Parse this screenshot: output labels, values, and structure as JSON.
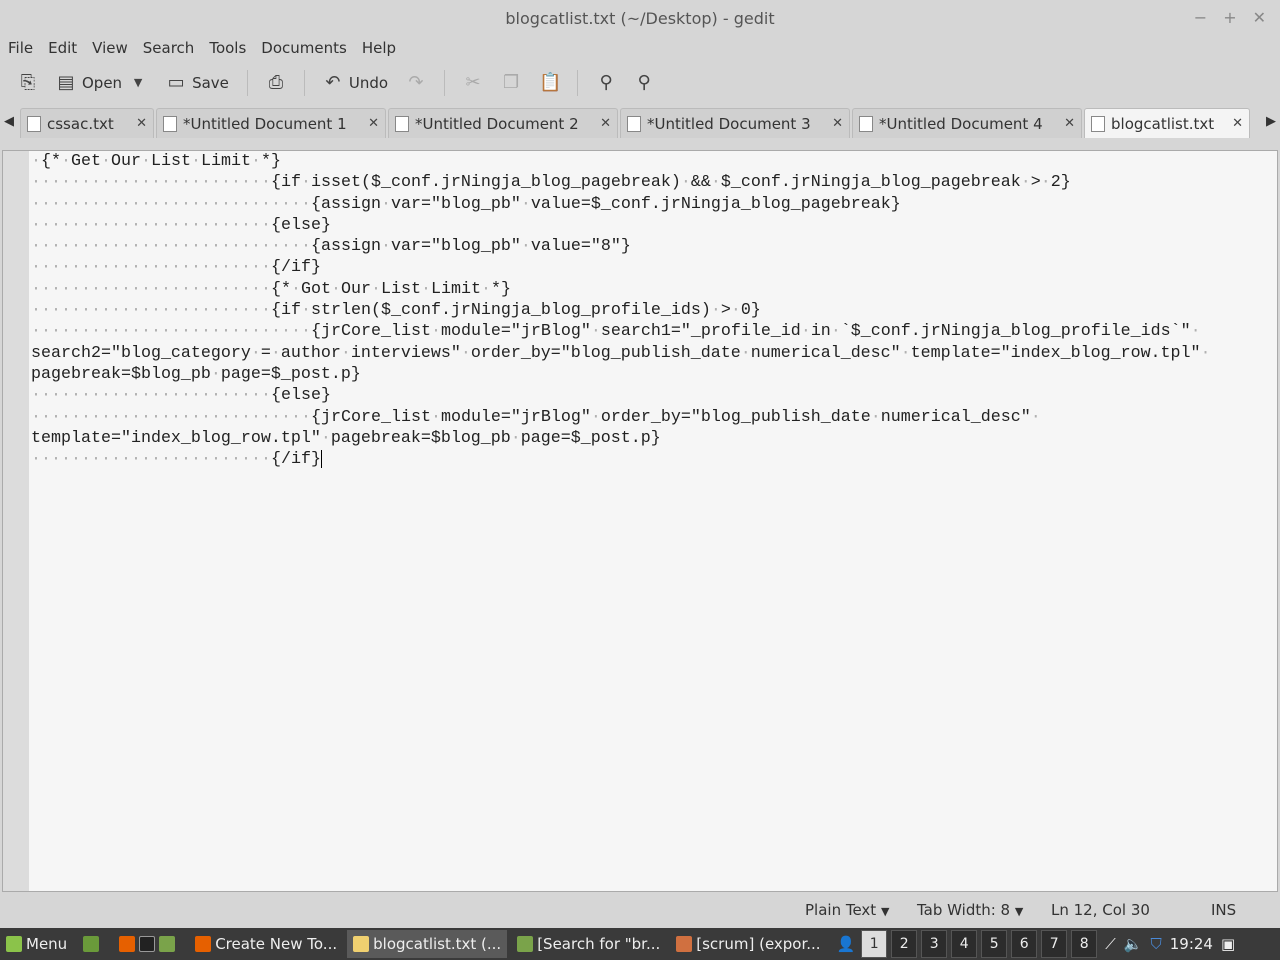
{
  "window": {
    "title": "blogcatlist.txt (~/Desktop) - gedit"
  },
  "menu": [
    "File",
    "Edit",
    "View",
    "Search",
    "Tools",
    "Documents",
    "Help"
  ],
  "toolbar": {
    "open_label": "Open",
    "save_label": "Save",
    "undo_label": "Undo"
  },
  "tabs": [
    {
      "label": "cssac.txt"
    },
    {
      "label": "*Untitled Document 1"
    },
    {
      "label": "*Untitled Document 2"
    },
    {
      "label": "*Untitled Document 3"
    },
    {
      "label": "*Untitled Document 4"
    },
    {
      "label": "blogcatlist.txt"
    }
  ],
  "code_lines": [
    " {* Get Our List Limit *}",
    "                        {if isset($_conf.jrNingja_blog_pagebreak) && $_conf.jrNingja_blog_pagebreak > 2}",
    "                            {assign var=\"blog_pb\" value=$_conf.jrNingja_blog_pagebreak}",
    "                        {else}",
    "                            {assign var=\"blog_pb\" value=\"8\"}",
    "                        {/if}",
    "                        {* Got Our List Limit *}",
    "                        {if strlen($_conf.jrNingja_blog_profile_ids) > 0}",
    "                            {jrCore_list module=\"jrBlog\" search1=\"_profile_id in `$_conf.jrNingja_blog_profile_ids`\" ",
    "search2=\"blog_category = author interviews\" order_by=\"blog_publish_date numerical_desc\" template=\"index_blog_row.tpl\" ",
    "pagebreak=$blog_pb page=$_post.p}",
    "                        {else}",
    "                            {jrCore_list module=\"jrBlog\" order_by=\"blog_publish_date numerical_desc\" ",
    "template=\"index_blog_row.tpl\" pagebreak=$blog_pb page=$_post.p}",
    "                        {/if}"
  ],
  "status": {
    "language": "Plain Text",
    "tab_width": "Tab Width: 8",
    "position": "Ln 12, Col 30",
    "mode": "INS"
  },
  "taskbar": {
    "menu_label": "Menu",
    "windows": [
      "Create New To...",
      "blogcatlist.txt (...",
      "[Search for \"br...",
      "[scrum] (expor..."
    ],
    "workspaces": [
      "1",
      "2",
      "3",
      "4",
      "5",
      "6",
      "7",
      "8"
    ],
    "clock": "19:24"
  }
}
